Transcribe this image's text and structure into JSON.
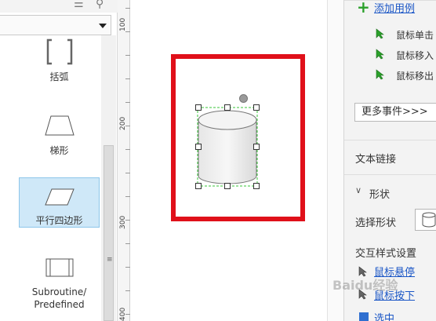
{
  "widgets": [
    {
      "label": "括弧",
      "icon": "bracket-icon"
    },
    {
      "label": "梯形",
      "icon": "trapezoid-icon"
    },
    {
      "label": "平行四边形",
      "icon": "parallelogram-icon"
    },
    {
      "label": "Subroutine/\nPredefined",
      "icon": "subroutine-icon"
    }
  ],
  "ruler": {
    "labels": [
      "100",
      "200",
      "300",
      "400"
    ]
  },
  "right_panel": {
    "add_case": "添加用例",
    "events": [
      "鼠标单击",
      "鼠标移入",
      "鼠标移出"
    ],
    "more_events": "更多事件>>>",
    "text_link": "文本链接",
    "shape_section": "形状",
    "select_shape": "选择形状",
    "interaction_style": "交互样式设置",
    "style_links": [
      "鼠标悬停",
      "鼠标按下",
      "选中"
    ]
  },
  "watermark": "Baidu经验",
  "colors": {
    "accent_green": "#2aa02a",
    "link_blue": "#1a56c6",
    "frame_red": "#e0101a",
    "selection_blue": "#cfe8f8"
  }
}
